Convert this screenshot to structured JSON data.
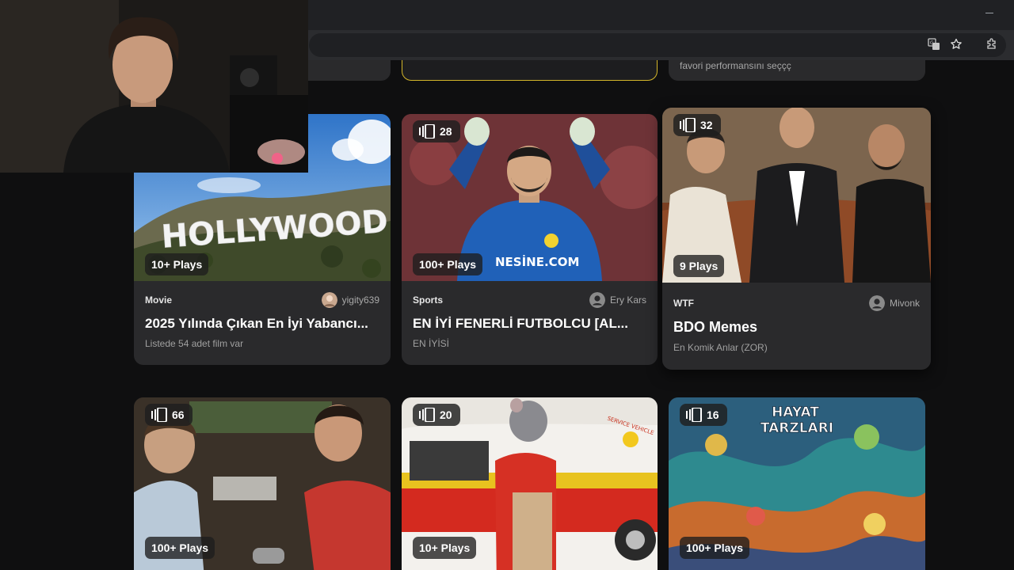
{
  "browser": {
    "icons": [
      "translate-icon",
      "star-icon",
      "extensions-icon",
      "minimize-icon"
    ]
  },
  "top_row": {
    "partial_text": "favori performansını seççç"
  },
  "cards": [
    {
      "count": "",
      "plays": "10+ Plays",
      "category": "Movie",
      "author": "yigity639",
      "title": "2025 Yılında Çıkan En İyi Yabancı...",
      "description": "Listede 54 adet film var"
    },
    {
      "count": "28",
      "plays": "100+ Plays",
      "category": "Sports",
      "author": "Ery Kars",
      "title": "EN İYİ FENERLİ FUTBOLCU [AL...",
      "description": "EN İYİSİ"
    },
    {
      "count": "32",
      "plays": "9 Plays",
      "category": "WTF",
      "author": "Mivonk",
      "title": "BDO Memes",
      "description": "En Komik Anlar (ZOR)"
    },
    {
      "count": "66",
      "plays": "100+ Plays"
    },
    {
      "count": "20",
      "plays": "10+ Plays"
    },
    {
      "count": "16",
      "plays": "100+ Plays"
    }
  ],
  "images": {
    "hollywood_sign": "HOLLYWOOD",
    "jersey_sponsor": "NESİNE.COM",
    "poster_title_line1": "HAYAT",
    "poster_title_line2": "TARZLARI",
    "van_text": "SERVICE VEHICLE"
  },
  "colors": {
    "page_bg": "#0f0f10",
    "card_bg": "#2a2a2c",
    "selected_border": "#d4b62a"
  }
}
